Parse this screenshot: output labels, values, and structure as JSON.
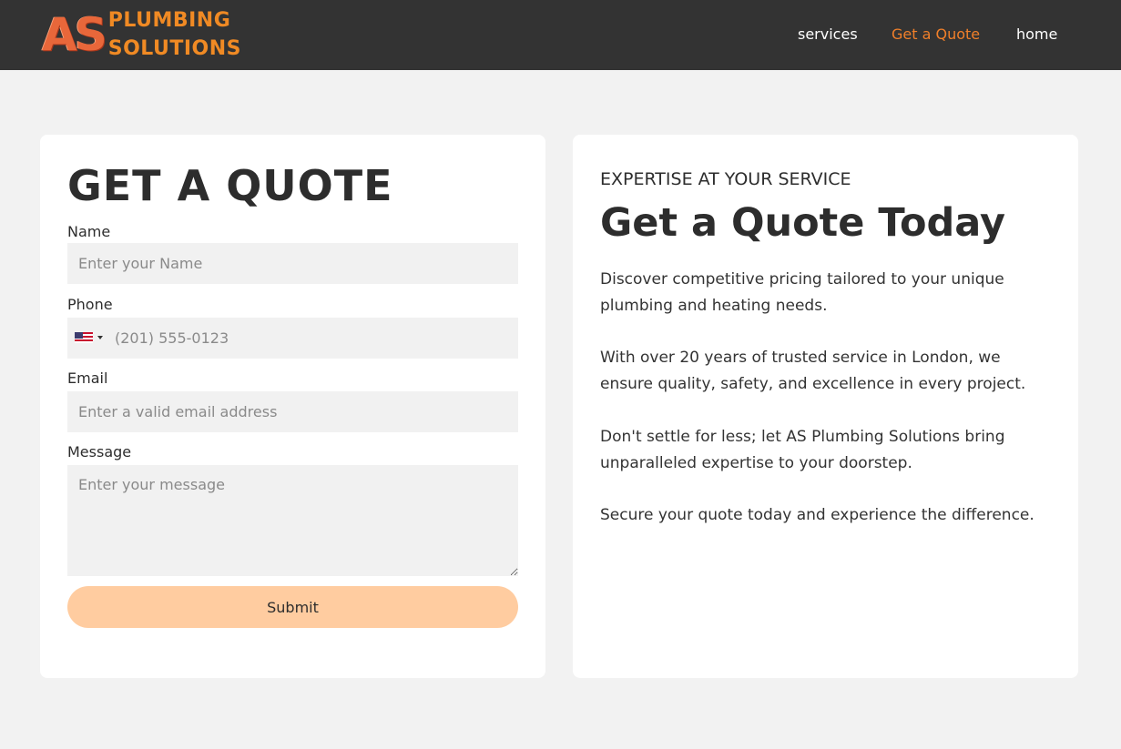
{
  "header": {
    "logo": {
      "mark": "AS",
      "line1": "PLUMBING",
      "line2": "SOLUTIONS"
    },
    "nav": [
      {
        "label": "services",
        "active": false
      },
      {
        "label": "Get a Quote",
        "active": true
      },
      {
        "label": "home",
        "active": false
      }
    ]
  },
  "form": {
    "title": "GET A QUOTE",
    "fields": {
      "name": {
        "label": "Name",
        "placeholder": "Enter your Name",
        "value": ""
      },
      "phone": {
        "label": "Phone",
        "placeholder": "(201) 555-0123",
        "value": "",
        "country_flag": "us-flag-icon"
      },
      "email": {
        "label": "Email",
        "placeholder": "Enter a valid email address",
        "value": ""
      },
      "message": {
        "label": "Message",
        "placeholder": "Enter your message",
        "value": ""
      }
    },
    "submit_label": "Submit"
  },
  "info": {
    "eyebrow": "EXPERTISE AT YOUR SERVICE",
    "title": "Get a Quote Today",
    "paragraphs": [
      "Discover competitive pricing tailored to your unique plumbing and heating needs.",
      "With over 20 years of trusted service in London, we ensure quality, safety, and excellence in every project.",
      "Don't settle for less; let AS Plumbing Solutions bring unparalleled expertise to your doorstep.",
      "Secure your quote today and experience the difference."
    ]
  },
  "colors": {
    "header_bg": "#333333",
    "accent": "#f07f2a",
    "submit_bg": "#ffcca0",
    "page_bg": "#f2f2f2"
  }
}
